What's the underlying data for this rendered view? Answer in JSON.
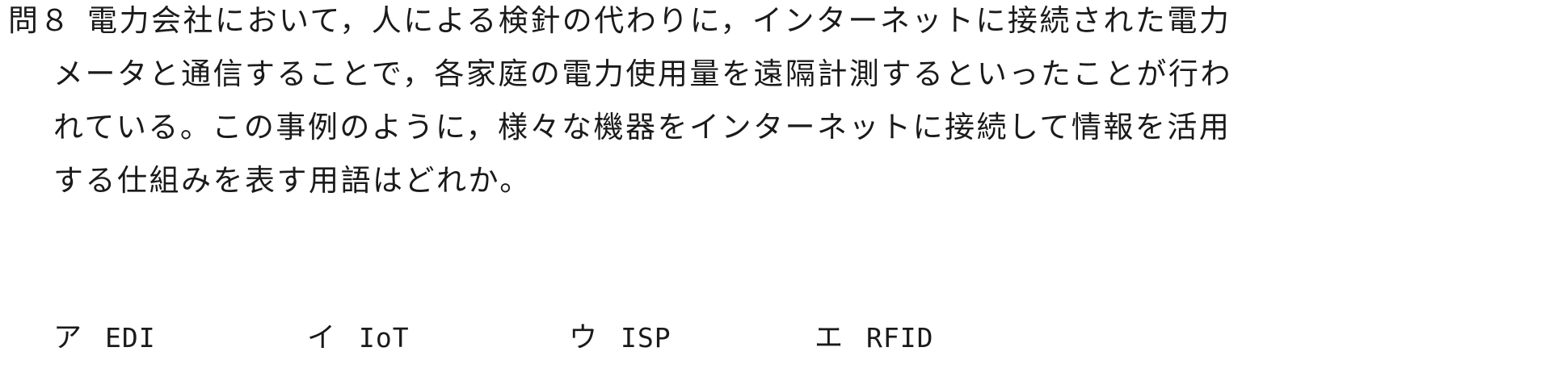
{
  "question": {
    "number": "問８",
    "lines": [
      "電力会社において，人による検針の代わりに，インターネットに接続された電力",
      "メータと通信することで，各家庭の電力使用量を遠隔計測するといったことが行わ",
      "れている。この事例のように，様々な機器をインターネットに接続して情報を活用",
      "する仕組みを表す用語はどれか。"
    ]
  },
  "choices": [
    {
      "mark": "ア",
      "text": "EDI"
    },
    {
      "mark": "イ",
      "text": "IoT"
    },
    {
      "mark": "ウ",
      "text": "ISP"
    },
    {
      "mark": "エ",
      "text": "RFID"
    }
  ]
}
